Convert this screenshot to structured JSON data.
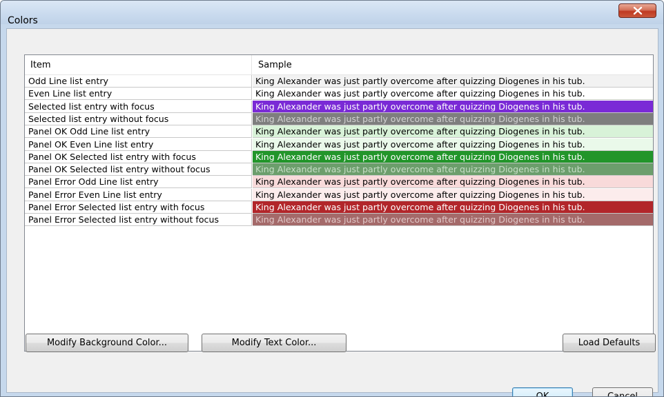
{
  "window": {
    "title": "Colors",
    "close_icon": "close-x-icon"
  },
  "list": {
    "columns": {
      "item": "Item",
      "sample": "Sample"
    },
    "rows": [
      {
        "item": "Odd Line list entry",
        "sample": "King Alexander was just partly overcome after quizzing Diogenes in his tub.",
        "bg": "#f2f2f2",
        "fg": "#000000"
      },
      {
        "item": "Even Line list entry",
        "sample": "King Alexander was just partly overcome after quizzing Diogenes in his tub.",
        "bg": "#ffffff",
        "fg": "#000000"
      },
      {
        "item": "Selected list entry with focus",
        "sample": "King Alexander was just partly overcome after quizzing Diogenes in his tub.",
        "bg": "#7a2ad6",
        "fg": "#ffffff"
      },
      {
        "item": "Selected list entry without focus",
        "sample": "King Alexander was just partly overcome after quizzing Diogenes in his tub.",
        "bg": "#7e7e7e",
        "fg": "#d2d2d2"
      },
      {
        "item": "Panel OK Odd Line list entry",
        "sample": "King Alexander was just partly overcome after quizzing Diogenes in his tub.",
        "bg": "#d8f2d8",
        "fg": "#000000"
      },
      {
        "item": "Panel OK Even Line list entry",
        "sample": "King Alexander was just partly overcome after quizzing Diogenes in his tub.",
        "bg": "#eaf9ea",
        "fg": "#000000"
      },
      {
        "item": "Panel OK Selected list entry with focus",
        "sample": "King Alexander was just partly overcome after quizzing Diogenes in his tub.",
        "bg": "#22952a",
        "fg": "#ffffff"
      },
      {
        "item": "Panel OK Selected list entry without focus",
        "sample": "King Alexander was just partly overcome after quizzing Diogenes in his tub.",
        "bg": "#6c9e6c",
        "fg": "#c8dec8"
      },
      {
        "item": "Panel Error Odd Line list entry",
        "sample": "King Alexander was just partly overcome after quizzing Diogenes in his tub.",
        "bg": "#f8dada",
        "fg": "#000000"
      },
      {
        "item": "Panel Error Even Line list entry",
        "sample": "King Alexander was just partly overcome after quizzing Diogenes in his tub.",
        "bg": "#fcecec",
        "fg": "#000000"
      },
      {
        "item": "Panel Error Selected list entry with focus",
        "sample": "King Alexander was just partly overcome after quizzing Diogenes in his tub.",
        "bg": "#b2262a",
        "fg": "#ffffff"
      },
      {
        "item": "Panel Error Selected list entry without focus",
        "sample": "King Alexander was just partly overcome after quizzing Diogenes in his tub.",
        "bg": "#a46a6a",
        "fg": "#e0c8c8"
      }
    ]
  },
  "buttons": {
    "modify_background": "Modify Background Color...",
    "modify_text": "Modify Text Color...",
    "load_defaults": "Load Defaults",
    "ok": "OK",
    "cancel": "Cancel"
  }
}
